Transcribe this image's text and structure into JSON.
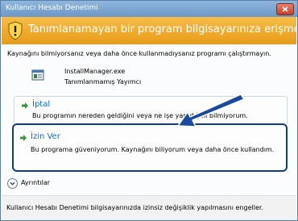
{
  "window": {
    "title": "Kullanıcı Hesabı Denetimi"
  },
  "banner": {
    "heading": "Tanımlanamayan bir program bilgisayarınıza erişmek istiyor"
  },
  "intro": {
    "text": "Kaynağını bilmiyorsanız veya daha önce kullanmadıysanız programı çalıştırmayın."
  },
  "program": {
    "name": "InstallManager.exe",
    "publisher": "Tanımlanmamış Yayımcı"
  },
  "options": {
    "cancel": {
      "title": "İptal",
      "description": "Bu programın nereden geldiğini veya ne işe yaradığını bilmiyorum."
    },
    "allow": {
      "title": "İzin Ver",
      "description": "Bu programa güveniyorum. Kaynağını biliyorum veya daha önce kullandım."
    }
  },
  "details": {
    "label": "Ayrıntılar"
  },
  "footer": {
    "text": "Kullanıcı Hesabı Denetimi bilgisayarınızda izinsiz değişiklik yapılmasını engeller."
  },
  "colors": {
    "banner": "#eba52b",
    "link": "#0d6bd1",
    "annotation_arrow": "#1a4a9c"
  }
}
